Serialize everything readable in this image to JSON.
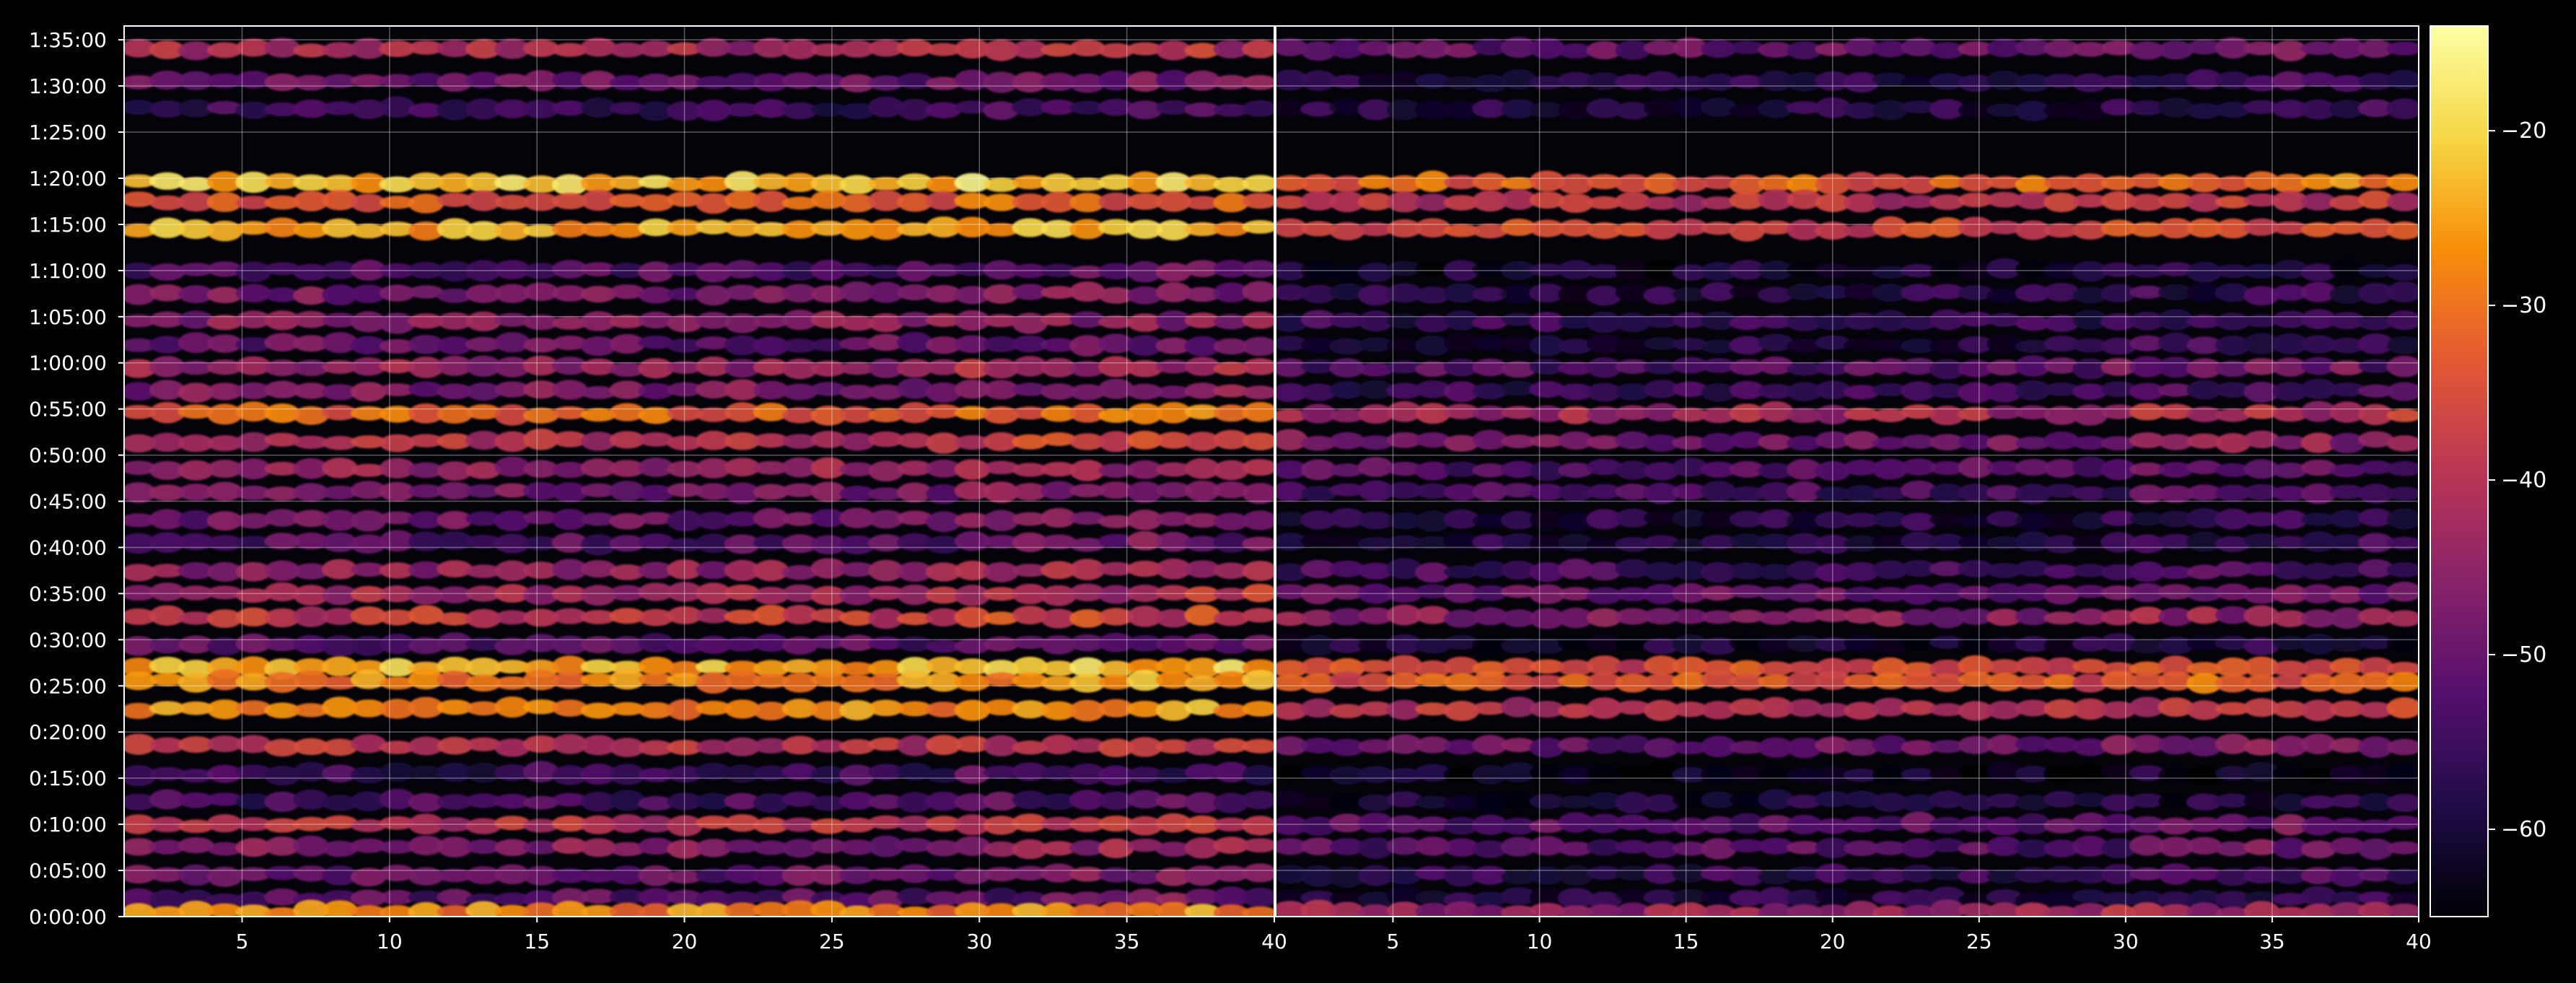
{
  "chart_data": {
    "type": "heatmap",
    "title": "",
    "xlabel": "",
    "ylabel": "",
    "background": "#000000",
    "colormap": "inferno",
    "grid": true,
    "panels": [
      {
        "name": "",
        "xlim": [
          1,
          40
        ],
        "x_ticks": [
          5,
          10,
          15,
          20,
          25,
          30,
          35,
          40
        ],
        "row_levels": [
          {
            "time": "1:34:00",
            "level": -42
          },
          {
            "time": "1:30:30",
            "level": -50
          },
          {
            "time": "1:27:30",
            "level": -55
          },
          {
            "time": "1:19:30",
            "level": -22
          },
          {
            "time": "1:17:30",
            "level": -34
          },
          {
            "time": "1:14:30",
            "level": -24
          },
          {
            "time": "1:10:00",
            "level": -52
          },
          {
            "time": "1:07:30",
            "level": -48
          },
          {
            "time": "1:04:30",
            "level": -46
          },
          {
            "time": "1:02:00",
            "level": -50
          },
          {
            "time": "0:59:30",
            "level": -44
          },
          {
            "time": "0:57:00",
            "level": -47
          },
          {
            "time": "0:54:30",
            "level": -32
          },
          {
            "time": "0:51:30",
            "level": -40
          },
          {
            "time": "0:48:30",
            "level": -44
          },
          {
            "time": "0:46:00",
            "level": -48
          },
          {
            "time": "0:43:00",
            "level": -50
          },
          {
            "time": "0:40:30",
            "level": -52
          },
          {
            "time": "0:37:30",
            "level": -45
          },
          {
            "time": "0:35:00",
            "level": -42
          },
          {
            "time": "0:32:30",
            "level": -38
          },
          {
            "time": "0:29:30",
            "level": -52
          },
          {
            "time": "0:27:00",
            "level": -24
          },
          {
            "time": "0:25:30",
            "level": -28
          },
          {
            "time": "0:22:30",
            "level": -27
          },
          {
            "time": "0:18:30",
            "level": -40
          },
          {
            "time": "0:15:30",
            "level": -56
          },
          {
            "time": "0:12:30",
            "level": -54
          },
          {
            "time": "0:10:00",
            "level": -40
          },
          {
            "time": "0:07:30",
            "level": -46
          },
          {
            "time": "0:04:30",
            "level": -50
          },
          {
            "time": "0:02:00",
            "level": -52
          },
          {
            "time": "0:00:30",
            "level": -28
          }
        ]
      },
      {
        "name": "",
        "xlim": [
          1,
          40
        ],
        "x_ticks": [
          5,
          10,
          15,
          20,
          25,
          30,
          35,
          40
        ],
        "row_levels": [
          {
            "time": "1:34:00",
            "level": -50
          },
          {
            "time": "1:30:30",
            "level": -58
          },
          {
            "time": "1:27:30",
            "level": -58
          },
          {
            "time": "1:19:30",
            "level": -32
          },
          {
            "time": "1:17:30",
            "level": -40
          },
          {
            "time": "1:14:30",
            "level": -36
          },
          {
            "time": "1:10:00",
            "level": -60
          },
          {
            "time": "1:07:30",
            "level": -58
          },
          {
            "time": "1:04:30",
            "level": -56
          },
          {
            "time": "1:02:00",
            "level": -58
          },
          {
            "time": "0:59:30",
            "level": -52
          },
          {
            "time": "0:57:00",
            "level": -56
          },
          {
            "time": "0:54:30",
            "level": -42
          },
          {
            "time": "0:51:30",
            "level": -48
          },
          {
            "time": "0:48:30",
            "level": -52
          },
          {
            "time": "0:46:00",
            "level": -54
          },
          {
            "time": "0:43:00",
            "level": -58
          },
          {
            "time": "0:40:30",
            "level": -58
          },
          {
            "time": "0:37:30",
            "level": -54
          },
          {
            "time": "0:35:00",
            "level": -50
          },
          {
            "time": "0:32:30",
            "level": -46
          },
          {
            "time": "0:29:30",
            "level": -60
          },
          {
            "time": "0:27:00",
            "level": -36
          },
          {
            "time": "0:25:30",
            "level": -34
          },
          {
            "time": "0:22:30",
            "level": -40
          },
          {
            "time": "0:18:30",
            "level": -50
          },
          {
            "time": "0:15:30",
            "level": -62
          },
          {
            "time": "0:12:30",
            "level": -60
          },
          {
            "time": "0:10:00",
            "level": -52
          },
          {
            "time": "0:07:30",
            "level": -52
          },
          {
            "time": "0:04:30",
            "level": -56
          },
          {
            "time": "0:02:00",
            "level": -58
          },
          {
            "time": "0:00:30",
            "level": -44
          }
        ]
      }
    ],
    "y_ticks": [
      "0:00:00",
      "0:05:00",
      "0:10:00",
      "0:15:00",
      "0:20:00",
      "0:25:00",
      "0:30:00",
      "0:35:00",
      "0:40:00",
      "0:45:00",
      "0:50:00",
      "0:55:00",
      "1:00:00",
      "1:05:00",
      "1:10:00",
      "1:15:00",
      "1:20:00",
      "1:25:00",
      "1:30:00",
      "1:35:00"
    ],
    "colorbar": {
      "range": [
        -65,
        -14
      ],
      "ticks": [
        -20,
        -30,
        -40,
        -50,
        -60
      ],
      "tick_labels": [
        "−20",
        "−30",
        "−40",
        "−50",
        "−60"
      ]
    }
  }
}
